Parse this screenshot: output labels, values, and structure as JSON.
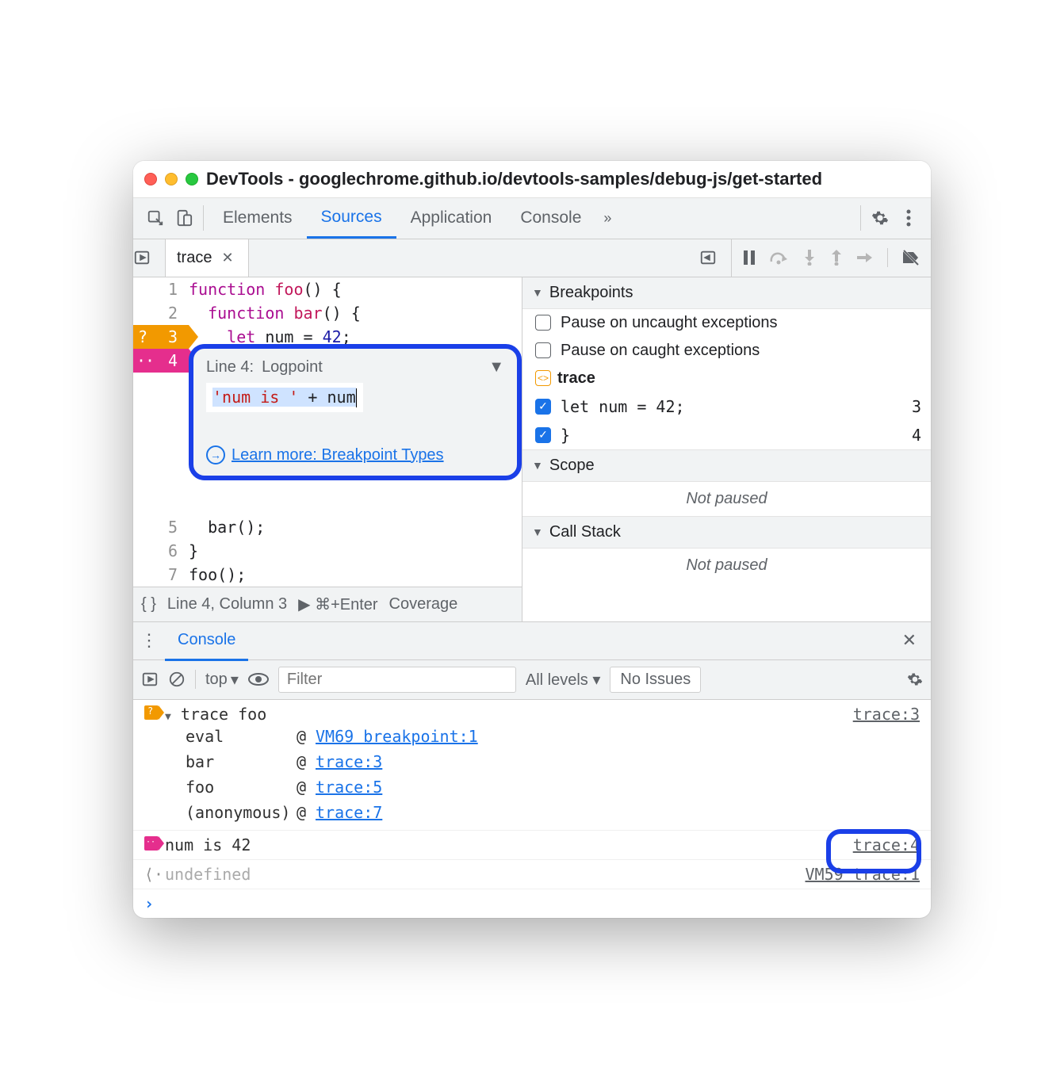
{
  "window": {
    "title": "DevTools - googlechrome.github.io/devtools-samples/debug-js/get-started"
  },
  "mainTabs": {
    "elements": "Elements",
    "sources": "Sources",
    "application": "Application",
    "console": "Console",
    "more": "»"
  },
  "fileTab": {
    "name": "trace"
  },
  "code": {
    "lines": [
      {
        "n": "1",
        "pre": "",
        "kw": "function",
        "fn": " foo",
        "post": "() {"
      },
      {
        "n": "2",
        "pre": "  ",
        "kw": "function",
        "fn": " bar",
        "post": "() {"
      },
      {
        "n": "3",
        "pre": "    ",
        "kw": "let",
        "mid": " num = ",
        "lit": "42",
        "post": ";"
      },
      {
        "n": "4",
        "pre": "  ",
        "post": "}"
      },
      {
        "n": "5",
        "pre": "  ",
        "post": "bar();"
      },
      {
        "n": "6",
        "pre": "",
        "post": "}"
      },
      {
        "n": "7",
        "pre": "",
        "post": "foo();"
      }
    ]
  },
  "popup": {
    "line": "Line 4:",
    "type": "Logpoint",
    "exprStr": "'num is '",
    "exprRest": " + num",
    "learn": "Learn more: Breakpoint Types"
  },
  "editorFooter": {
    "pretty": "{ }",
    "pos": "Line 4, Column 3",
    "run": "▶ ⌘+Enter",
    "cov": "Coverage"
  },
  "debugger": {
    "breakpoints": {
      "title": "Breakpoints",
      "uncaught": "Pause on uncaught exceptions",
      "caught": "Pause on caught exceptions",
      "file": "trace",
      "items": [
        {
          "code": "let num = 42;",
          "line": "3"
        },
        {
          "code": "}",
          "line": "4"
        }
      ]
    },
    "scope": {
      "title": "Scope",
      "msg": "Not paused"
    },
    "callstack": {
      "title": "Call Stack",
      "msg": "Not paused"
    }
  },
  "drawer": {
    "tab": "Console",
    "context": "top",
    "filterPlaceholder": "Filter",
    "levels": "All levels ▾",
    "issues": "No Issues"
  },
  "console": {
    "traceTitle": "trace foo",
    "traceSrc": "trace:3",
    "stack": [
      {
        "name": "eval",
        "link": "VM69 breakpoint:1"
      },
      {
        "name": "bar",
        "link": "trace:3"
      },
      {
        "name": "foo",
        "link": "trace:5"
      },
      {
        "name": "(anonymous)",
        "link": "trace:7"
      }
    ],
    "log": {
      "text": "num is 42",
      "src": "trace:4"
    },
    "undef": {
      "text": "undefined",
      "src": "VM59 trace:1"
    }
  }
}
